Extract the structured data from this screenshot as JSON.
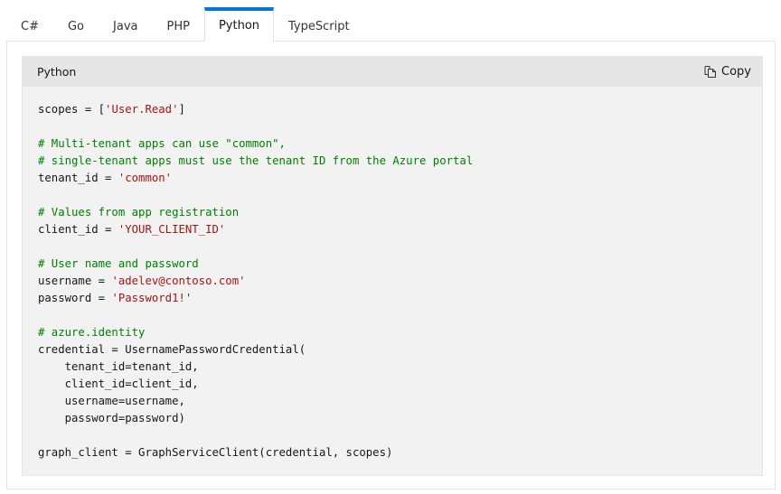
{
  "tabs": [
    {
      "label": "C#",
      "active": false
    },
    {
      "label": "Go",
      "active": false
    },
    {
      "label": "Java",
      "active": false
    },
    {
      "label": "PHP",
      "active": false
    },
    {
      "label": "Python",
      "active": true
    },
    {
      "label": "TypeScript",
      "active": false
    }
  ],
  "code_block": {
    "language_label": "Python",
    "copy_label": "Copy",
    "copy_icon": "copy-icon",
    "lines": [
      [
        {
          "t": "scopes = [",
          "c": ""
        },
        {
          "t": "'User.Read'",
          "c": "st"
        },
        {
          "t": "]",
          "c": ""
        }
      ],
      [],
      [
        {
          "t": "# Multi-tenant apps can use \"common\",",
          "c": "cm"
        }
      ],
      [
        {
          "t": "# single-tenant apps must use the tenant ID from the Azure portal",
          "c": "cm"
        }
      ],
      [
        {
          "t": "tenant_id = ",
          "c": ""
        },
        {
          "t": "'common'",
          "c": "st"
        }
      ],
      [],
      [
        {
          "t": "# Values from app registration",
          "c": "cm"
        }
      ],
      [
        {
          "t": "client_id = ",
          "c": ""
        },
        {
          "t": "'YOUR_CLIENT_ID'",
          "c": "st"
        }
      ],
      [],
      [
        {
          "t": "# User name and password",
          "c": "cm"
        }
      ],
      [
        {
          "t": "username = ",
          "c": ""
        },
        {
          "t": "'adelev@contoso.com'",
          "c": "st"
        }
      ],
      [
        {
          "t": "password = ",
          "c": ""
        },
        {
          "t": "'Password1!'",
          "c": "st"
        }
      ],
      [],
      [
        {
          "t": "# azure.identity",
          "c": "cm"
        }
      ],
      [
        {
          "t": "credential = UsernamePasswordCredential(",
          "c": ""
        }
      ],
      [
        {
          "t": "    tenant_id=tenant_id,",
          "c": ""
        }
      ],
      [
        {
          "t": "    client_id=client_id,",
          "c": ""
        }
      ],
      [
        {
          "t": "    username=username,",
          "c": ""
        }
      ],
      [
        {
          "t": "    password=password)",
          "c": ""
        }
      ],
      [],
      [
        {
          "t": "graph_client = GraphServiceClient(credential, scopes)",
          "c": ""
        }
      ]
    ]
  },
  "colors": {
    "accent": "#0078d4",
    "comment": "#008000",
    "string": "#a31515"
  }
}
